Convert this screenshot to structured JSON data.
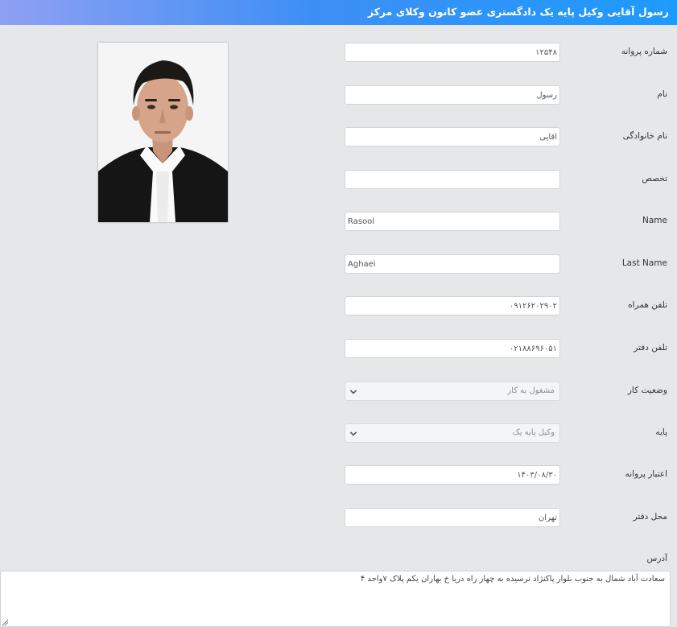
{
  "header": {
    "title": "رسول آقایی وکیل پایه یک دادگستری عضو کانون وکلای مرکز"
  },
  "fields": [
    {
      "id": "license_number",
      "label": "شماره پروانه",
      "value": "۱۲۵۴۸",
      "dir": "rtl"
    },
    {
      "id": "first_name",
      "label": "نام",
      "value": "رسول",
      "dir": "rtl"
    },
    {
      "id": "last_name_fa",
      "label": "نام خانوادگی",
      "value": "آقایی",
      "dir": "rtl"
    },
    {
      "id": "specialty",
      "label": "تخصص",
      "value": "",
      "dir": "rtl"
    },
    {
      "id": "name_en",
      "label": "Name",
      "value": "Rasool",
      "dir": "ltr"
    },
    {
      "id": "last_name_en",
      "label": "Last Name",
      "value": "Aghaei",
      "dir": "ltr"
    },
    {
      "id": "mobile",
      "label": "تلفن همراه",
      "value": "۰۹۱۲۶۲۰۲۹۰۲",
      "dir": "rtl"
    },
    {
      "id": "office_phone",
      "label": "تلفن دفتر",
      "value": "۰۲۱۸۸۶۹۶۰۵۱",
      "dir": "rtl"
    }
  ],
  "selects": [
    {
      "id": "work_status",
      "label": "وضعیت کار",
      "value": "مشغول به کار"
    },
    {
      "id": "grade",
      "label": "پایه",
      "value": "وکیل پایه یک"
    }
  ],
  "fields2": [
    {
      "id": "license_validity",
      "label": "اعتبار پروانه",
      "value": "۱۴۰۳/۰۸/۳۰",
      "dir": "rtl"
    },
    {
      "id": "office_location",
      "label": "محل دفتر",
      "value": "تهران",
      "dir": "rtl"
    }
  ],
  "address": {
    "label": "آدرس",
    "value": "سعادت آباد شمال به جنوب بلوار پاکنژاد نرسیده به چهار راه دریا خ بهاران یکم پلاک ۷واحد ۴"
  },
  "colors": {
    "header_start": "#8fa0f3",
    "header_end": "#1e9afd",
    "background": "#e6e7e9"
  },
  "photo": {
    "icon": "lawyer-portrait"
  }
}
